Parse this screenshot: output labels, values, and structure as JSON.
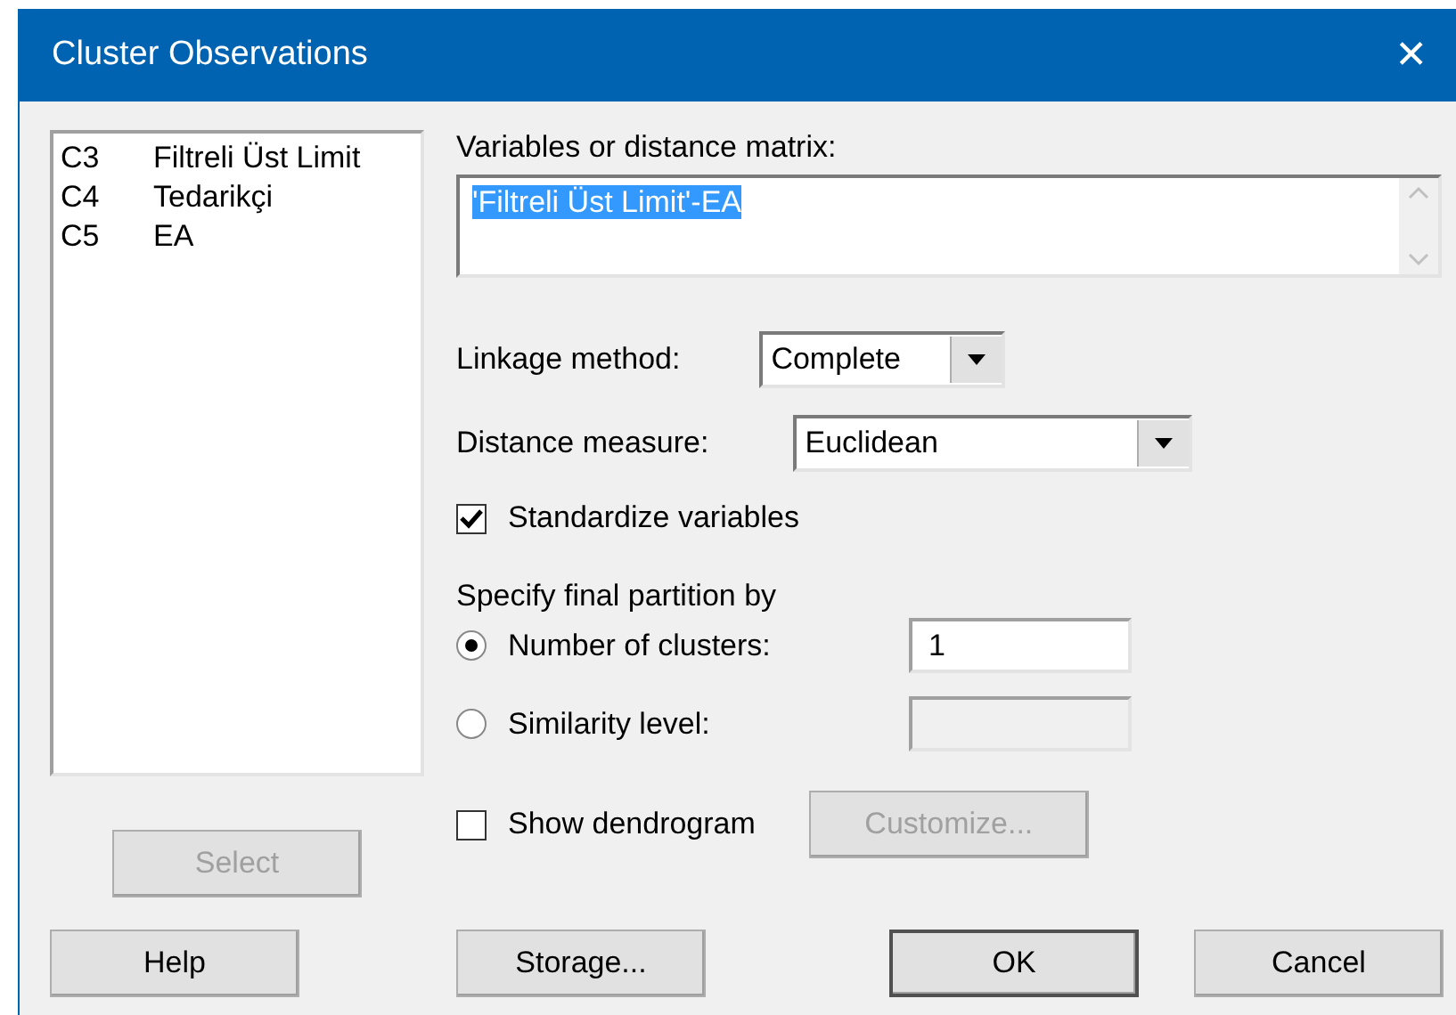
{
  "window": {
    "title": "Cluster Observations",
    "close": "✕"
  },
  "columns": [
    {
      "id": "C3",
      "name": "Filtreli Üst Limit"
    },
    {
      "id": "C4",
      "name": "Tedarikçi"
    },
    {
      "id": "C5",
      "name": "EA"
    }
  ],
  "select_button": {
    "label": "Select",
    "disabled": true
  },
  "variables": {
    "label": "Variables or distance matrix:",
    "value": "'Filtreli Üst Limit'-EA",
    "highlighted": true
  },
  "linkage": {
    "label": "Linkage method:",
    "value": "Complete"
  },
  "distance": {
    "label": "Distance measure:",
    "value": "Euclidean"
  },
  "standardize": {
    "label": "Standardize variables",
    "checked": true
  },
  "partition": {
    "heading": "Specify final partition by",
    "options": [
      {
        "label": "Number of clusters:",
        "selected": true,
        "value": "1"
      },
      {
        "label": "Similarity level:",
        "selected": false
      }
    ]
  },
  "dendrogram": {
    "label": "Show dendrogram",
    "checked": false
  },
  "customize_button": {
    "label": "Customize...",
    "disabled": true
  },
  "buttons": [
    {
      "label": "Help",
      "default": false
    },
    {
      "label": "Storage...",
      "default": false
    },
    {
      "label": "OK",
      "default": true
    },
    {
      "label": "Cancel",
      "default": false
    }
  ]
}
